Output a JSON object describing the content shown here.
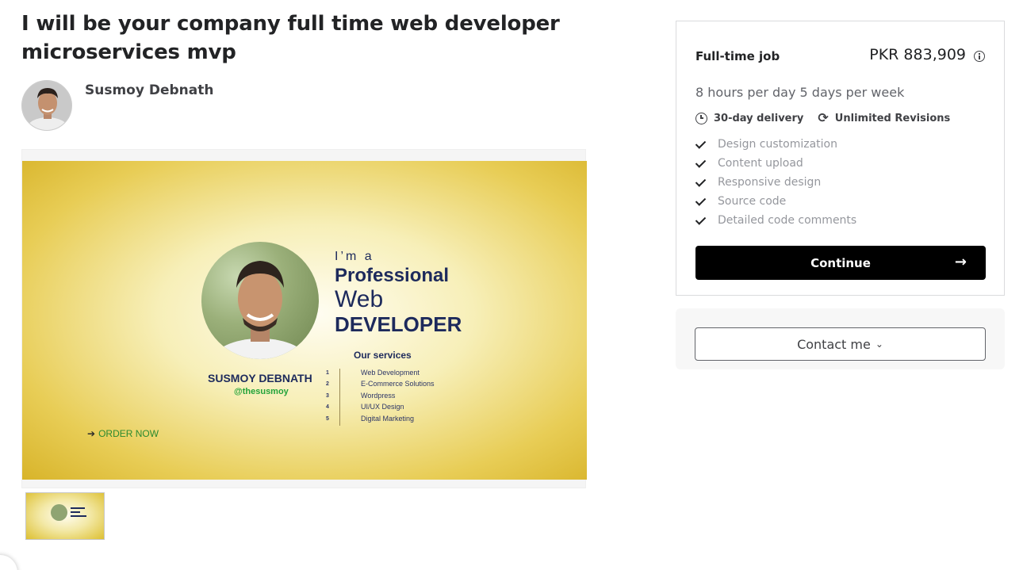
{
  "gig": {
    "title": "I will be your company full time web developer microservices mvp",
    "seller_name": "Susmoy Debnath"
  },
  "banner": {
    "im_a": "I’m a",
    "professional": "Professional",
    "web": "Web",
    "developer": "DEVELOPER",
    "name": "SUSMOY DEBNATH",
    "handle": "@thesusmoy",
    "services_title": "Our services",
    "services": [
      {
        "num": "1",
        "text": "Web Development"
      },
      {
        "num": "2",
        "text": "E-Commerce Solutions"
      },
      {
        "num": "3",
        "text": "Wordpress"
      },
      {
        "num": "4",
        "text": "UI/UX Design"
      },
      {
        "num": "5",
        "text": "Digital Marketing"
      }
    ],
    "order_arrow": "➔",
    "order_now": "ORDER NOW"
  },
  "package": {
    "name": "Full-time job",
    "price": "PKR 883,909",
    "description": "8 hours per day 5 days per week",
    "delivery": "30-day delivery",
    "revisions": "Unlimited Revisions",
    "features": [
      "Design customization",
      "Content upload",
      "Responsive design",
      "Source code",
      "Detailed code comments"
    ],
    "continue_label": "Continue",
    "continue_arrow": "→"
  },
  "contact": {
    "label": "Contact me",
    "chevron": "⌄"
  },
  "icons": {
    "clock": "clock-icon",
    "refresh": "refresh-icon",
    "check": "check-icon",
    "info": "info-icon"
  }
}
